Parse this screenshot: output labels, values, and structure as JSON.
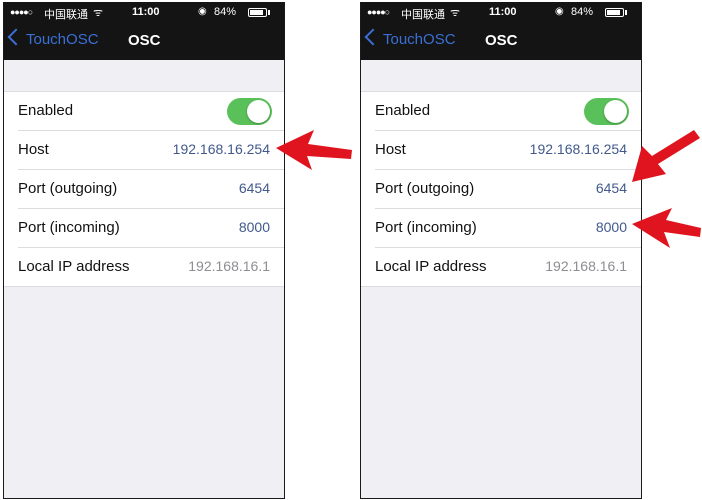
{
  "status_bar": {
    "signal": "●●●●○",
    "carrier": "中国联通",
    "wifi": "ᯤ",
    "time": "11:00",
    "lock": "◉",
    "battery": "84%"
  },
  "nav": {
    "back_label": "TouchOSC",
    "title": "OSC"
  },
  "settings": {
    "enabled_label": "Enabled",
    "enabled": true,
    "host_label": "Host",
    "host_value": "192.168.16.254",
    "port_out_label": "Port (outgoing)",
    "port_out_value": "6454",
    "port_in_label": "Port (incoming)",
    "port_in_value": "8000",
    "local_ip_label": "Local IP address",
    "local_ip_value": "192.168.16.1"
  },
  "colors": {
    "toggle_on": "#5ac15a",
    "link_blue": "#3a70d6",
    "value_blue": "#41598c",
    "arrow_red": "#e0141e"
  }
}
